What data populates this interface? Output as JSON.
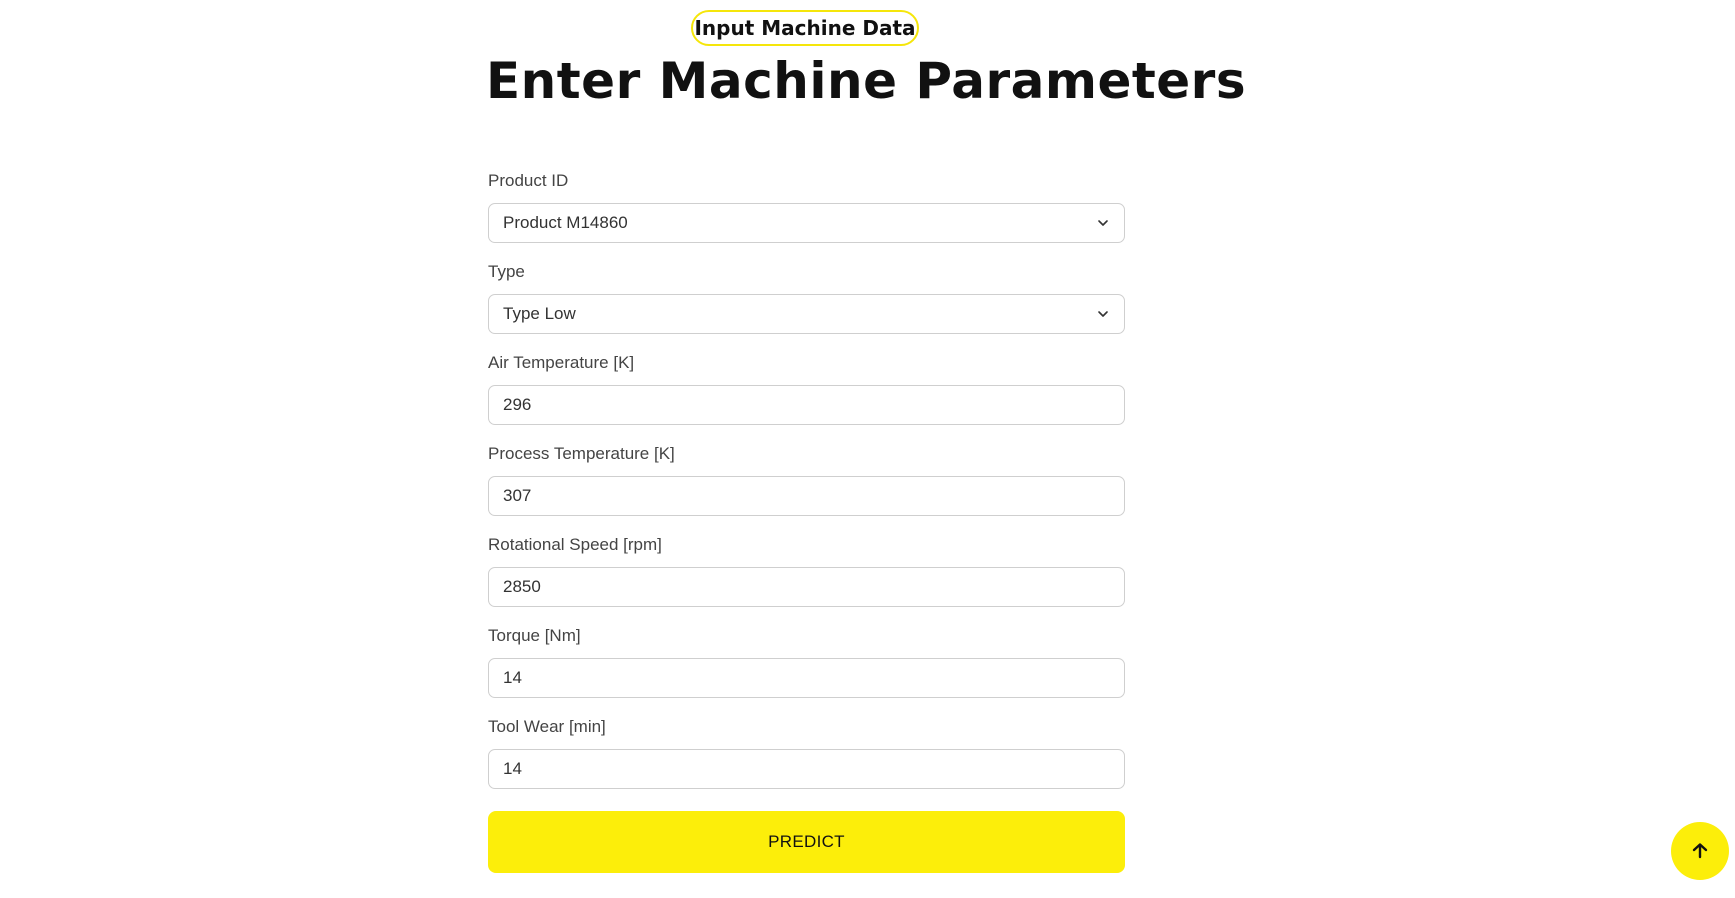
{
  "header": {
    "badge": "Input Machine Data",
    "title": "Enter Machine Parameters"
  },
  "form": {
    "product_id": {
      "label": "Product ID",
      "value": "Product M14860"
    },
    "type": {
      "label": "Type",
      "value": "Type Low"
    },
    "air_temperature": {
      "label": "Air Temperature [K]",
      "value": "296"
    },
    "process_temperature": {
      "label": "Process Temperature [K]",
      "value": "307"
    },
    "rotational_speed": {
      "label": "Rotational Speed [rpm]",
      "value": "2850"
    },
    "torque": {
      "label": "Torque [Nm]",
      "value": "14"
    },
    "tool_wear": {
      "label": "Tool Wear [min]",
      "value": "14"
    },
    "submit_label": "PREDICT"
  },
  "icons": {
    "dropdown": "chevron-down-icon",
    "scroll_top": "arrow-up-icon"
  },
  "colors": {
    "accent": "#fcee0a",
    "badge_border": "#f5e60a"
  }
}
